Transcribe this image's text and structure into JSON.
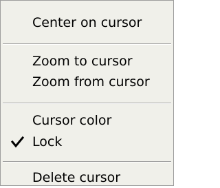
{
  "menu": {
    "items": [
      {
        "label": "Center on cursor",
        "checked": false
      },
      {
        "label": "Zoom to cursor",
        "checked": false
      },
      {
        "label": "Zoom from cursor",
        "checked": false
      },
      {
        "label": "Cursor color",
        "checked": false
      },
      {
        "label": "Lock",
        "checked": true
      },
      {
        "label": "Delete cursor",
        "checked": false
      }
    ],
    "check_icon": "checkmark-icon"
  }
}
